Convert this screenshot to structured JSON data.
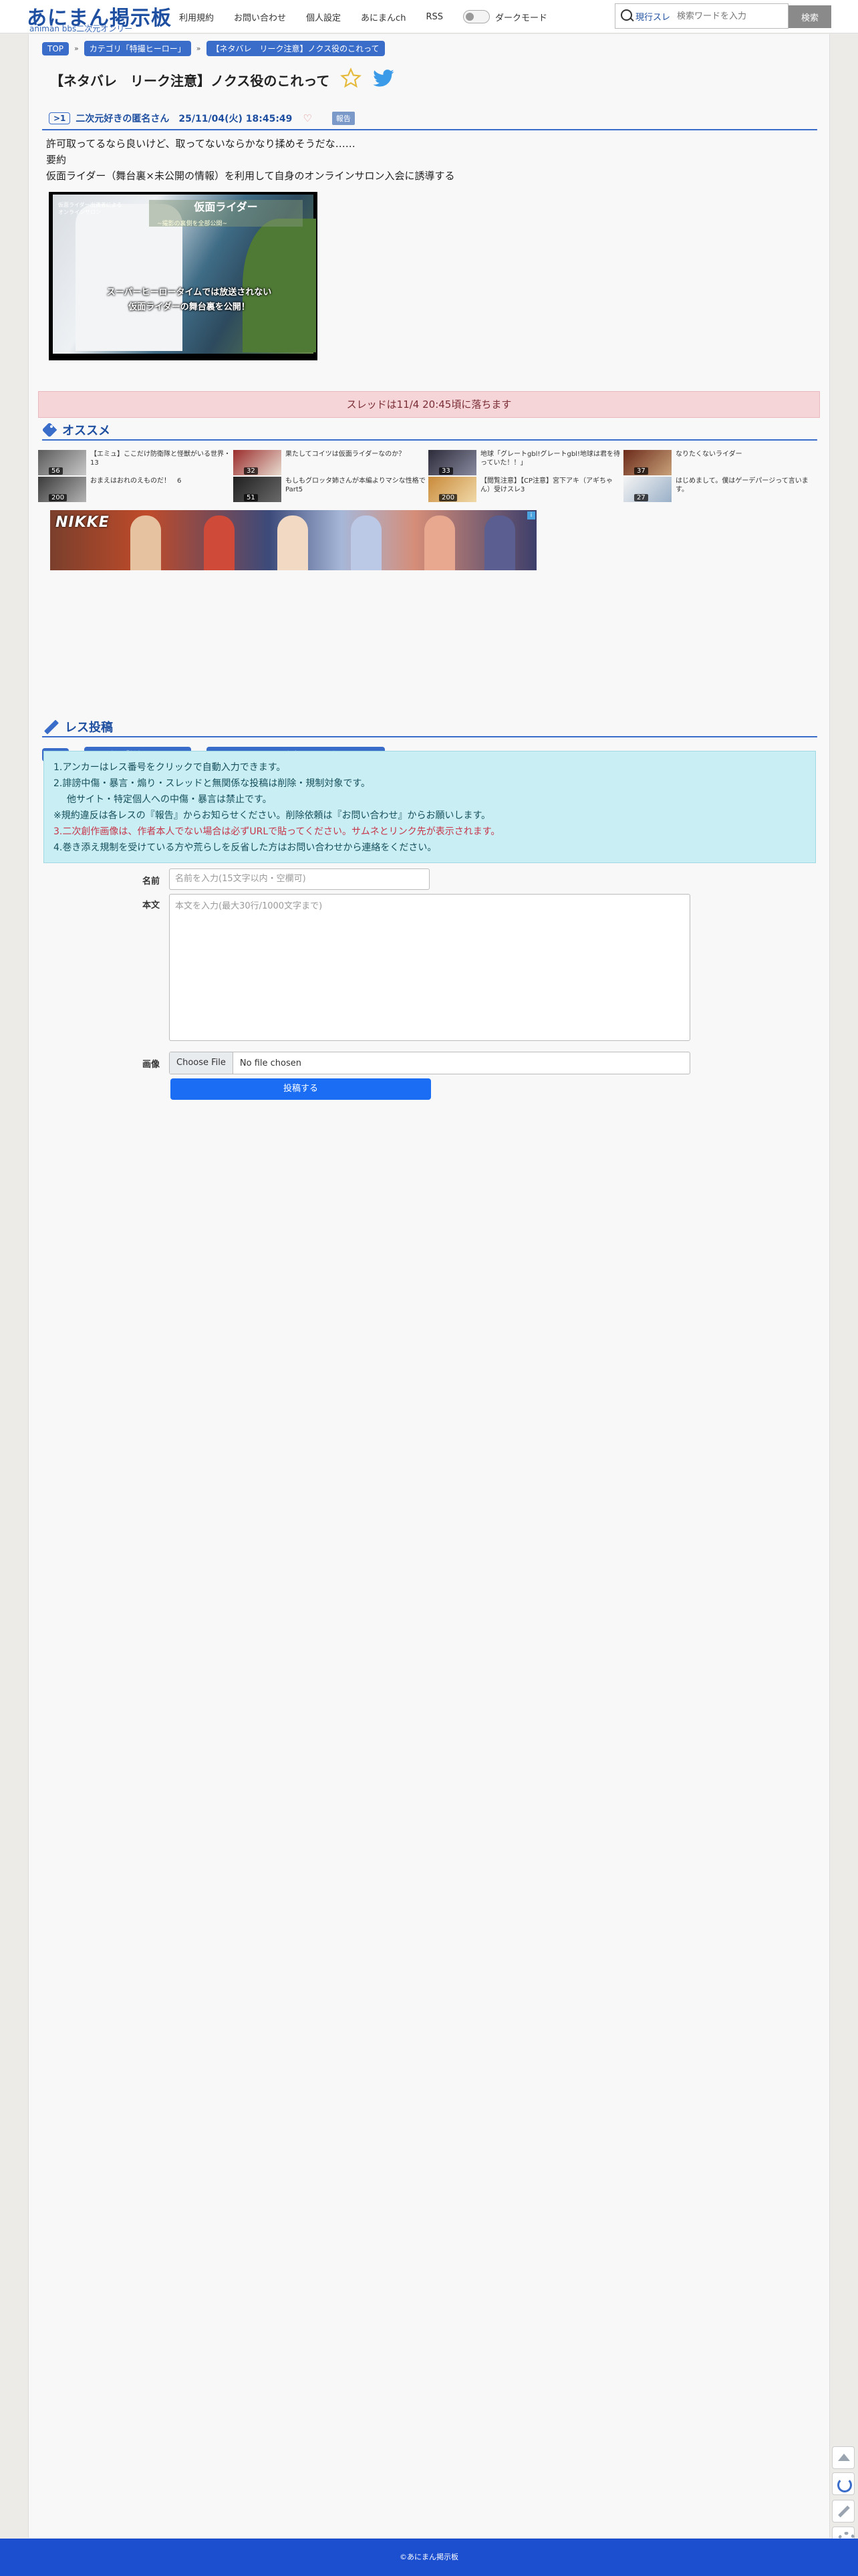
{
  "header": {
    "logo_main": "あにまん掲示板",
    "logo_sub": "animan bbs二次元オンリー",
    "nav": [
      "利用規約",
      "お問い合わせ",
      "個人設定",
      "あにまんch",
      "RSS"
    ],
    "dark_mode_label": "ダークモード",
    "search_scope": "現行スレ",
    "search_placeholder": "検索ワードを入力",
    "search_button": "検索"
  },
  "breadcrumb": {
    "items": [
      "TOP",
      "カテゴリ「特撮ヒーロー」",
      "【ネタバレ　リーク注意】ノクス役のこれって"
    ],
    "sep": "»"
  },
  "thread": {
    "title": "【ネタバレ　リーク注意】ノクス役のこれって"
  },
  "post": {
    "number": ">1",
    "author_date": "二次元好きの匿名さん　25/11/04(火) 18:45:49",
    "report_label": "報告",
    "lines": [
      "許可取ってるなら良いけど、取ってないならかなり揉めそうだな……",
      "要約",
      "仮面ライダー（舞台裏×未公開の情報）を利用して自身のオンラインサロン入会に誘導する"
    ],
    "image": {
      "banner": "仮面ライダー",
      "banner_sub": "~撮影の裏側を全部公開~",
      "corner_text": "仮面ライダー出演者によるオンラインサロン",
      "caption_1": "スーパーヒーロータイムでは放送されない",
      "caption_2": "仮面ライダーの舞台裏を公開！"
    }
  },
  "thread_closed": "スレッドは11/4 20:45頃に落ちます",
  "recommend": {
    "label": "オススメ",
    "items": [
      {
        "title": "【エミュ】ここだけ防衛隊と怪獣がいる世界・13",
        "count": "56"
      },
      {
        "title": "果たしてコイツは仮面ライダーなのか？",
        "count": "32"
      },
      {
        "title": "地球「グレートgbl!グレートgbl!地球は君を待っていた！！」",
        "count": "33"
      },
      {
        "title": "なりたくないライダー",
        "count": "37"
      },
      {
        "title": "おまえはおれのえものだ！　6",
        "count": "200"
      },
      {
        "title": "もしもグロッタ姉さんが本編よりマシな性格で Part5",
        "count": "51"
      },
      {
        "title": "【閲覧注意】【CP注意】宮下アキ（アギちゃん）受けスレ3",
        "count": "200"
      },
      {
        "title": "はじめまして。僕はゲーデパージって言います。",
        "count": "27"
      }
    ]
  },
  "ad": {
    "logo": "NIKKE",
    "info": "i"
  },
  "reply": {
    "label": "レス投稿",
    "rules": [
      "1.アンカーはレス番号をクリックで自動入力できます。",
      "2.誹謗中傷・暴言・煽り・スレッドと無関係な投稿は削除・規制対象です。",
      "他サイト・特定個人への中傷・暴言は禁止です。",
      "※規約違反は各レスの『報告』からお知らせください。削除依頼は『お問い合わせ』からお願いします。",
      "3.二次創作画像は、作者本人でない場合は必ずURLで貼ってください。サムネとリンク先が表示されます。",
      "4.巻き添え規制を受けている方や荒らしを反省した方はお問い合わせから連絡をください。"
    ],
    "name_label": "名前",
    "name_placeholder": "名前を入力(15文字以内・空欄可)",
    "body_label": "本文",
    "body_placeholder": "本文を入力(最大30行/1000文字まで)",
    "image_label": "画像",
    "file_button": "Choose File",
    "file_status": "No file chosen",
    "submit": "投稿する"
  },
  "footer": {
    "text": "©あにまん掲示板"
  },
  "colors": {
    "accent": "#3a6cc9",
    "footer": "#1c4fcf",
    "closed_bg": "#f6d5d9",
    "rules_bg": "#c9eef4",
    "submit": "#1b6ef3"
  },
  "icons": [
    "search-icon",
    "star-icon",
    "twitter-icon",
    "heart-icon",
    "tag-icon",
    "pencil-icon",
    "scroll-top-icon",
    "reload-icon",
    "edit-icon",
    "settings-icon"
  ]
}
